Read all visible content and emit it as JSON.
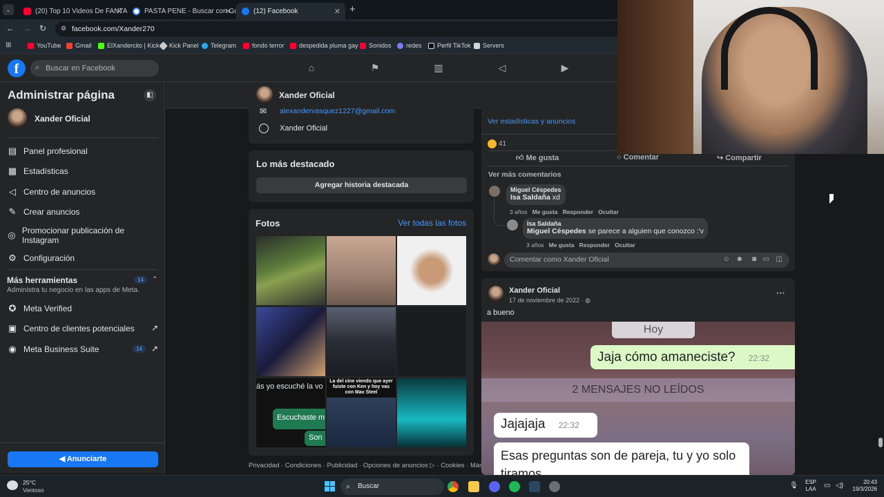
{
  "browser": {
    "tabs": [
      {
        "title": "(20) Top 10 Videos De FANTASM",
        "icon": "youtube-icon",
        "active": false
      },
      {
        "title": "PASTA PENE - Buscar con Goog",
        "icon": "google-icon",
        "active": false
      },
      {
        "title": "(12) Facebook",
        "icon": "facebook-icon",
        "active": true
      }
    ],
    "new_tab": "+",
    "url": "facebook.com/Xander270",
    "bookmarks": [
      "YouTube",
      "Gmail",
      "ElXandercito | Kick",
      "Kick Panel",
      "Telegram",
      "fondo terror",
      "despedida pluma gay",
      "Sonidos",
      "redes",
      "Perfil TikTok",
      "Servers"
    ]
  },
  "fb": {
    "logo": "f",
    "search_placeholder": "Buscar en Facebook",
    "nav_icons": [
      "home-icon",
      "flag-icon",
      "insights-icon",
      "megaphone-icon",
      "video-icon"
    ]
  },
  "sidebar": {
    "title": "Administrar página",
    "page_name": "Xander Oficial",
    "items": [
      {
        "label": "Panel profesional",
        "icon": "dashboard-icon"
      },
      {
        "label": "Estadísticas",
        "icon": "stats-icon"
      },
      {
        "label": "Centro de anuncios",
        "icon": "megaphone-icon"
      },
      {
        "label": "Crear anuncios",
        "icon": "edit-icon"
      },
      {
        "label": "Promocionar publicación de Instagram",
        "icon": "instagram-icon"
      },
      {
        "label": "Configuración",
        "icon": "gear-icon"
      }
    ],
    "tools_title": "Más herramientas",
    "tools_badge": "14",
    "tools_subtitle": "Administra tu negocio en las apps de Meta.",
    "tools": [
      {
        "label": "Meta Verified",
        "badge": "",
        "external": false
      },
      {
        "label": "Centro de clientes potenciales",
        "badge": "",
        "external": true
      },
      {
        "label": "Meta Business Suite",
        "badge": "14",
        "external": true
      }
    ],
    "ad_button": "Anunciarte"
  },
  "profile_header": {
    "name": "Xander Oficial"
  },
  "intro": {
    "email": "alexandervasquez1227@gmail.com",
    "messenger": "Xander Oficial"
  },
  "highlights": {
    "title": "Lo más destacado",
    "button": "Agregar historia destacada"
  },
  "photos": {
    "title": "Fotos",
    "see_all": "Ver todas las fotos",
    "overlay_texts": [
      "ás yo escuché la vo",
      "Escuchaste m",
      "Son",
      "La del cine viendo que ayer fuiste con Ken y hoy vas con Max Steel"
    ]
  },
  "footer": "Privacidad · Condiciones · Publicidad · Opciones de anuncios ▷ · Cookies · Más",
  "post1": {
    "stats_link": "Ver estadísticas y anuncios",
    "reaction_count": "41",
    "like": "Me gusta",
    "comment": "Comentar",
    "share": "Compartir",
    "see_more": "Ver más comentarios",
    "comments": [
      {
        "author": "Miguel Céspedes",
        "mention": "Isa Saldaña",
        "text": " xd",
        "age": "3 años",
        "like": "Me gusta",
        "reply": "Responder",
        "hide": "Ocultar"
      },
      {
        "author": "Isa Saldaña",
        "mention": "Miguel Céspedes",
        "text": " se parece a alguien que conozco :'v",
        "age": "3 años",
        "like": "Me gusta",
        "reply": "Responder",
        "hide": "Ocultar"
      }
    ],
    "comment_placeholder": "Comentar como Xander Oficial"
  },
  "post2": {
    "author": "Xander Oficial",
    "date": "17 de noviembre de 2022 · ",
    "more": "···",
    "text": "a bueno",
    "chat": {
      "date_pill": "Hoy",
      "msg1": "Jaja cómo amaneciste?",
      "time1": "22:32",
      "unread": "2 MENSAJES NO LEÍDOS",
      "msg2": "Jajajaja",
      "time2": "22:32",
      "msg3": "Esas preguntas son de pareja, tu y yo solo tiramos"
    }
  },
  "taskbar": {
    "weather_temp": "25°C",
    "weather_desc": "Ventoso",
    "search": "Buscar",
    "lang1": "ESP",
    "lang2": "LAA",
    "time": "20:43",
    "date": "19/3/2026"
  },
  "colors": {
    "fb_blue": "#1877f2",
    "link": "#4599ff",
    "card": "#242526",
    "bg": "#18191a"
  }
}
